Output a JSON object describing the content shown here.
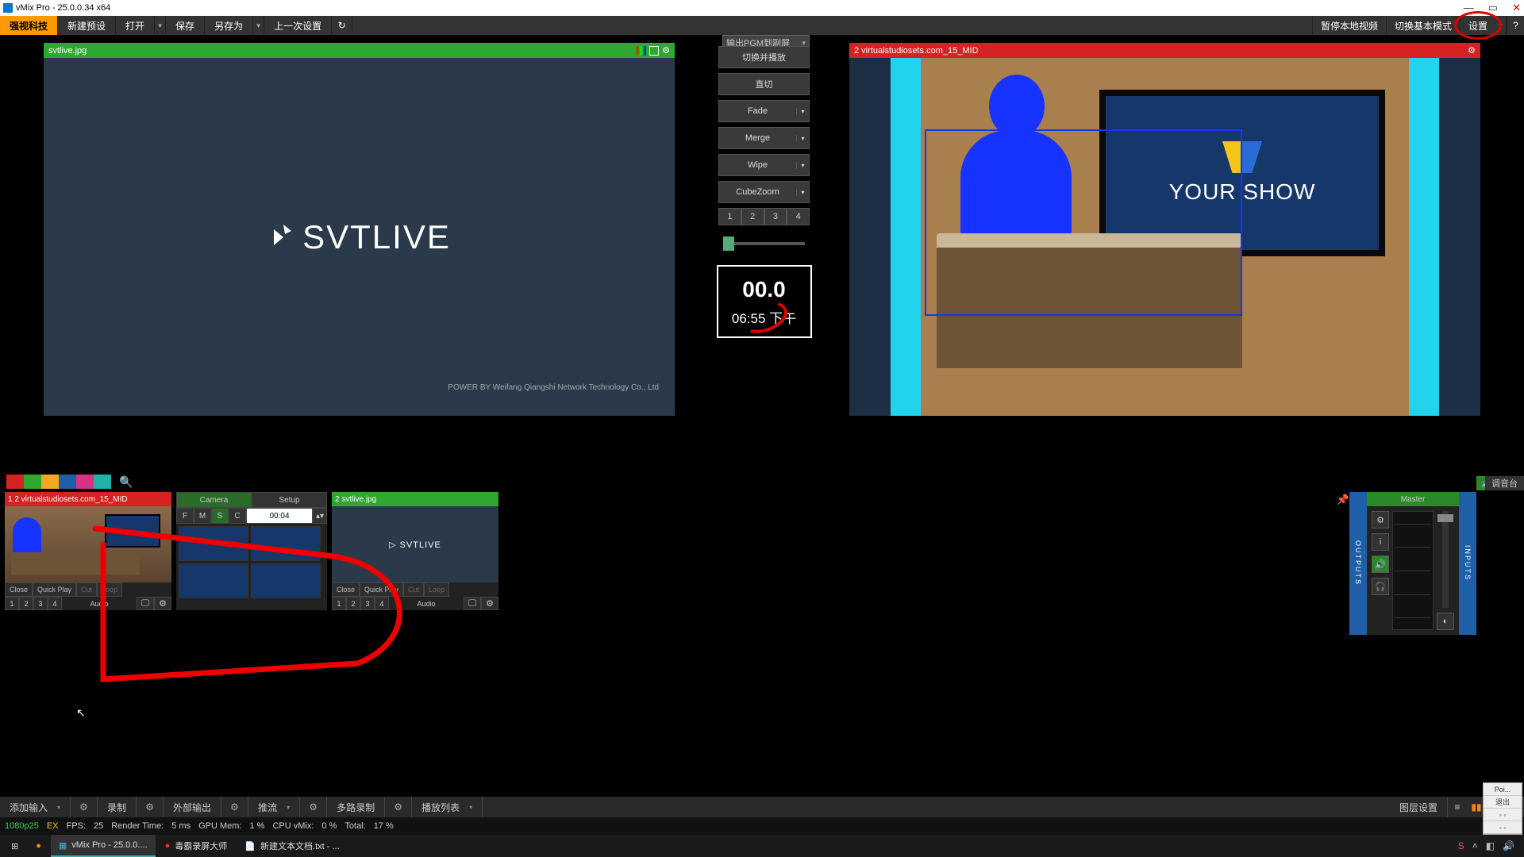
{
  "app": {
    "title": "vMix Pro - 25.0.0.34 x64"
  },
  "toolbar": {
    "logo": "强视科技",
    "new_preset": "新建预设",
    "open": "打开",
    "save": "保存",
    "save_as": "另存为",
    "last_settings": "上一次设置"
  },
  "toolbar_right": {
    "pause_local": "暂停本地视频",
    "switch_basic": "切换基本模式",
    "settings": "设置",
    "help": "?"
  },
  "output_select": {
    "label": "输出PGM到副屏"
  },
  "preview": {
    "title": "svtlive.jpg",
    "logo_text": "SVTLIVE",
    "credit_prefix": "POWER BY ",
    "credit": "Weifang Qiangshi Network Technology Co., Ltd"
  },
  "program": {
    "title": "2 virtualstudiosets.com_15_MID",
    "screen_text": "YOUR SHOW"
  },
  "transitions": {
    "switch_play": "切换并播放",
    "cut": "直切",
    "fade": "Fade",
    "merge": "Merge",
    "wipe": "Wipe",
    "cubezoom": "CubeZoom",
    "nums": [
      "1",
      "2",
      "3",
      "4"
    ]
  },
  "timer": {
    "main": "00.0",
    "clock": "06:55  下午"
  },
  "colors": [
    "#d52222",
    "#2fa82f",
    "#f5a623",
    "#1e5fa8",
    "#d63384",
    "#20b2aa"
  ],
  "camera_panel": {
    "tab_camera": "Camera",
    "tab_setup": "Setup",
    "F": "F",
    "M": "M",
    "S": "S",
    "C": "C",
    "time": "00:04"
  },
  "input1": {
    "title": "1  2 virtualstudiosets.com_15_MID",
    "close": "Close",
    "quick": "Quick Play",
    "cut": "Cut",
    "loop": "Loop",
    "audio": "Audio",
    "nums": [
      "1",
      "2",
      "3",
      "4"
    ]
  },
  "input2": {
    "title": "2  svtlive.jpg",
    "close": "Close",
    "quick": "Quick Play",
    "cut": "Cut",
    "loop": "Loop",
    "audio": "Audio",
    "nums": [
      "1",
      "2",
      "3",
      "4"
    ],
    "logo": "SVTLIVE"
  },
  "mixer": {
    "outputs": "OUTPUTS",
    "inputs": "INPUTS",
    "master": "Master"
  },
  "topmixer": {
    "btn": "调音台"
  },
  "bottom": {
    "add_input": "添加输入",
    "record": "录制",
    "external": "外部输出",
    "stream": "推流",
    "multirec": "多路录制",
    "playlist": "播放列表",
    "layer_settings": "图层设置"
  },
  "status": {
    "res": "1080p25",
    "ex": "EX",
    "fps_l": "FPS:",
    "fps_v": "25",
    "render_l": "Render Time:",
    "render_v": "5 ms",
    "gpu_l": "GPU Mem:",
    "gpu_v": "1 %",
    "cpu_l": "CPU vMix:",
    "cpu_v": "0 %",
    "tot_l": "Total:",
    "tot_v": "17 %"
  },
  "taskbar": {
    "vmix": "vMix Pro - 25.0.0....",
    "rec": "毒霸录屏大师",
    "txt": "新建文本文档.txt - ..."
  },
  "float": {
    "a": "Poi...",
    "b": "退出"
  }
}
